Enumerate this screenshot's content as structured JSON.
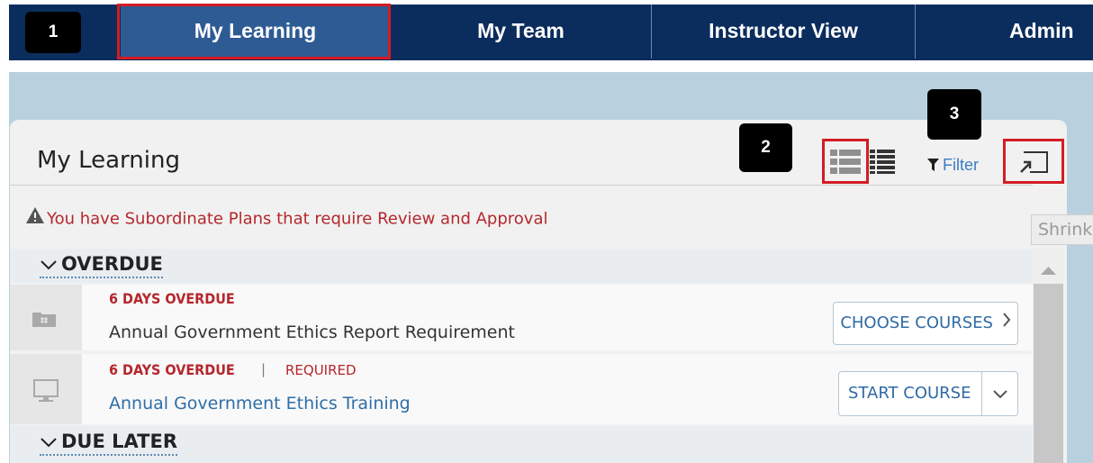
{
  "nav": {
    "callout": "1",
    "tabs": [
      {
        "label": "My Learning",
        "active": true
      },
      {
        "label": "My Team",
        "active": false
      },
      {
        "label": "Instructor View",
        "active": false
      },
      {
        "label": "Admin",
        "active": false
      }
    ]
  },
  "panel": {
    "title": "My Learning",
    "callout_view": "2",
    "callout_shrink": "3",
    "filter_label": "Filter",
    "tooltip": "Shrink"
  },
  "alert": {
    "text": "You have Subordinate Plans that require Review and Approval"
  },
  "sections": {
    "overdue": "OVERDUE",
    "due_later": "DUE LATER"
  },
  "items": [
    {
      "status": "6 DAYS OVERDUE",
      "title": "Annual Government Ethics Report Requirement",
      "action": "CHOOSE COURSES",
      "icon": "folder-icon"
    },
    {
      "status": "6 DAYS OVERDUE",
      "separator": "|",
      "flag": "REQUIRED",
      "title": "Annual Government Ethics Training",
      "action": "START COURSE",
      "icon": "monitor-icon"
    }
  ],
  "colors": {
    "nav_bg": "#0b2d5d",
    "nav_active": "#2e5b94",
    "highlight": "#d41c24",
    "alert": "#b5272d",
    "link": "#3b7dc4"
  }
}
